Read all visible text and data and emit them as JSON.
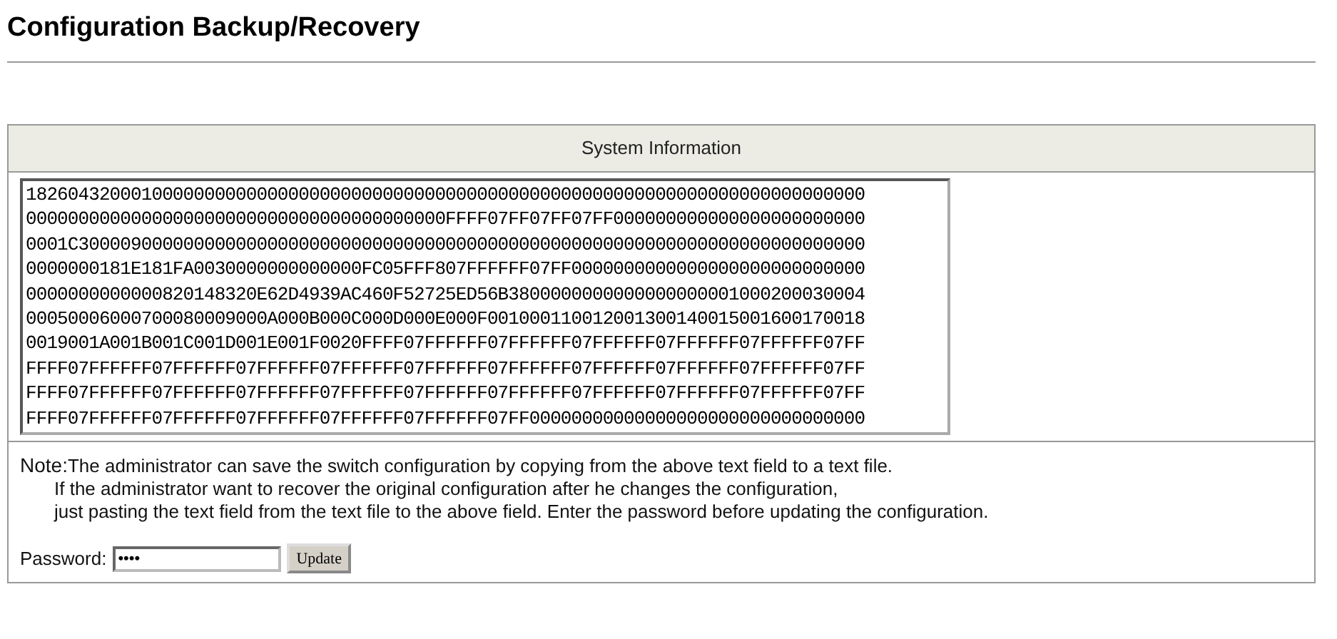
{
  "page_title": "Configuration Backup/Recovery",
  "panel": {
    "header": "System Information",
    "config_lines": [
      "18260432000100000000000000000000000000000000000000000000000000000000000000000000",
      "0000000000000000000000000000000000000000FFFF07FF07FF07FF000000000000000000000000",
      "0001C300009000000000000000000000000000000000000000000000000000000000000000000000",
      "0000000181E181FA0030000000000000FC05FFF807FFFFFF07FF0000000000000000000000000000",
      "0000000000000820148320E62D4939AC460F52725ED56B3800000000000000000001000200030004",
      "00050006000700080009000A000B000C000D000E000F001000110012001300140015001600170018",
      "0019001A001B001C001D001E001F0020FFFF07FFFFFF07FFFFFF07FFFFFF07FFFFFF07FFFFFF07FF",
      "FFFF07FFFFFF07FFFFFF07FFFFFF07FFFFFF07FFFFFF07FFFFFF07FFFFFF07FFFFFF07FFFFFF07FF",
      "FFFF07FFFFFF07FFFFFF07FFFFFF07FFFFFF07FFFFFF07FFFFFF07FFFFFF07FFFFFF07FFFFFF07FF",
      "FFFF07FFFFFF07FFFFFF07FFFFFF07FFFFFF07FFFFFF07FF00000000000000000000000000000000"
    ],
    "note_label": "Note:",
    "note_lines": [
      "The administrator can save the switch configuration by copying from the above text field to a text file.",
      "If the administrator want to recover the original configuration after he changes the configuration,",
      "just pasting the text field from the text file to the above field. Enter the password before updating the configuration."
    ],
    "password": {
      "label": "Password:",
      "value": "••••"
    },
    "button": "Update"
  }
}
